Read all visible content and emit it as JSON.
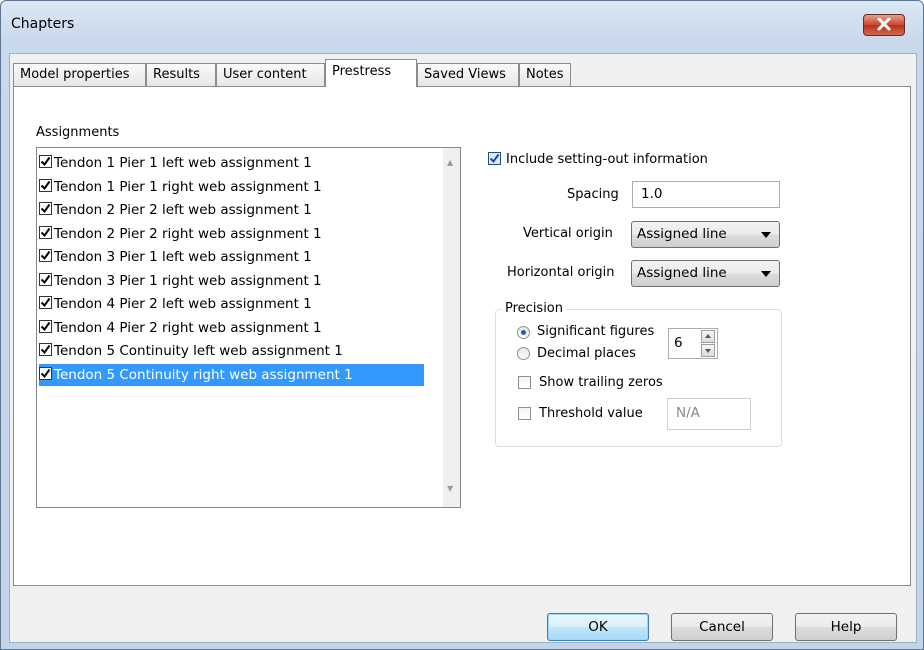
{
  "window": {
    "title": "Chapters"
  },
  "tabs": [
    {
      "label": "Model properties"
    },
    {
      "label": "Results"
    },
    {
      "label": "User content"
    },
    {
      "label": "Prestress"
    },
    {
      "label": "Saved Views"
    },
    {
      "label": "Notes"
    }
  ],
  "active_tab": "Prestress",
  "assignments": {
    "label": "Assignments",
    "items": [
      {
        "label": "Tendon 1 Pier 1 left web assignment 1",
        "checked": true
      },
      {
        "label": "Tendon 1 Pier 1 right web assignment 1",
        "checked": true
      },
      {
        "label": "Tendon 2 Pier 2 left web assignment 1",
        "checked": true
      },
      {
        "label": "Tendon 2 Pier 2 right web assignment 1",
        "checked": true
      },
      {
        "label": "Tendon 3 Pier 1 left web assignment 1",
        "checked": true
      },
      {
        "label": "Tendon 3 Pier 1 right web assignment 1",
        "checked": true
      },
      {
        "label": "Tendon 4 Pier 2 left web assignment 1",
        "checked": true
      },
      {
        "label": "Tendon 4 Pier 2 right web assignment 1",
        "checked": true
      },
      {
        "label": "Tendon 5 Continuity left web assignment 1",
        "checked": true
      },
      {
        "label": "Tendon 5 Continuity right web assignment 1",
        "checked": true,
        "selected": true
      }
    ]
  },
  "setting_out": {
    "include_label": "Include setting-out information",
    "include_checked": true,
    "spacing_label": "Spacing",
    "spacing_value": "1.0",
    "vertical_origin_label": "Vertical origin",
    "vertical_origin_value": "Assigned line",
    "horizontal_origin_label": "Horizontal origin",
    "horizontal_origin_value": "Assigned line"
  },
  "precision": {
    "group_label": "Precision",
    "significant_figures_label": "Significant figures",
    "significant_figures_selected": true,
    "decimal_places_label": "Decimal places",
    "decimal_places_selected": false,
    "digits_value": "6",
    "show_trailing_zeros_label": "Show trailing zeros",
    "show_trailing_zeros_checked": false,
    "threshold_label": "Threshold value",
    "threshold_checked": false,
    "threshold_value": "N/A"
  },
  "buttons": {
    "ok": "OK",
    "cancel": "Cancel",
    "help": "Help"
  },
  "colors": {
    "selection": "#3399ff",
    "title_bar": "#c9d9ec",
    "close_button": "#c8462f"
  }
}
